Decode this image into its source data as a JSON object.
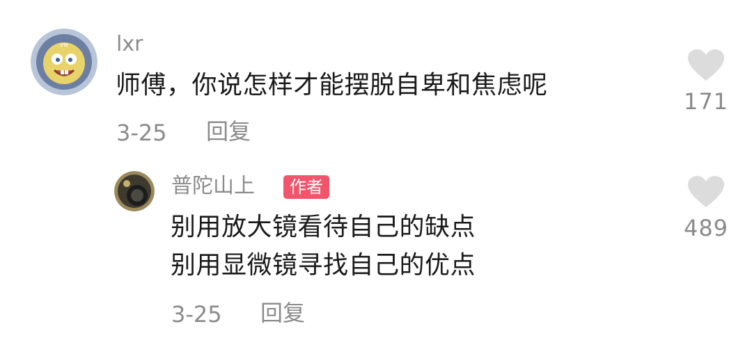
{
  "comment": {
    "username": "lxr",
    "text": "师傅，你说怎样才能摆脱自卑和焦虑呢",
    "date": "3-25",
    "reply_label": "回复",
    "like_count": "171"
  },
  "reply": {
    "username": "普陀山上",
    "badge": "作者",
    "lines": [
      "别用放大镜看待自己的缺点",
      "别用显微镜寻找自己的优点"
    ],
    "date": "3-25",
    "reply_label": "回复",
    "like_count": "489"
  },
  "colors": {
    "badge": "#f0556b",
    "secondary_text": "#8a8a8a",
    "primary_text": "#1a1a1a",
    "heart": "#dcdcdc"
  },
  "icons": {
    "like": "heart-icon"
  }
}
